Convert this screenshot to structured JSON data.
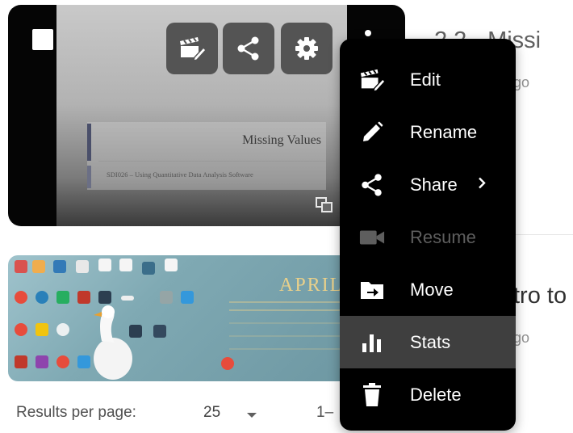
{
  "videos": [
    {
      "title": "2.2 - Missi",
      "subtitle": "go",
      "slide_title": "Missing Values",
      "slide_subtitle": "SDI026 – Using Quantitative Data Analysis Software",
      "overlay_icons": [
        "edit-icon",
        "share-icon",
        "settings-icon"
      ]
    },
    {
      "title": "tro to",
      "subtitle": "go",
      "calendar_title": "APRIL"
    }
  ],
  "pagination": {
    "results_label": "Results per page:",
    "results_value": "25",
    "range_text": "1–"
  },
  "menu": {
    "items": [
      {
        "label": "Edit",
        "icon": "edit-clapper-icon",
        "enabled": true,
        "highlighted": false
      },
      {
        "label": "Rename",
        "icon": "pencil-icon",
        "enabled": true,
        "highlighted": false
      },
      {
        "label": "Share",
        "icon": "share-icon",
        "enabled": true,
        "highlighted": false,
        "submenu": true
      },
      {
        "label": "Resume",
        "icon": "video-camera-icon",
        "enabled": false,
        "highlighted": false
      },
      {
        "label": "Move",
        "icon": "folder-move-icon",
        "enabled": true,
        "highlighted": false
      },
      {
        "label": "Stats",
        "icon": "bar-chart-icon",
        "enabled": true,
        "highlighted": true
      },
      {
        "label": "Delete",
        "icon": "trash-icon",
        "enabled": true,
        "highlighted": false
      }
    ]
  },
  "colors": {
    "menu_bg": "#000000",
    "menu_highlight": "#3f3f3f",
    "overlay_button": "#545454",
    "disabled_text": "#5e5e5e"
  }
}
